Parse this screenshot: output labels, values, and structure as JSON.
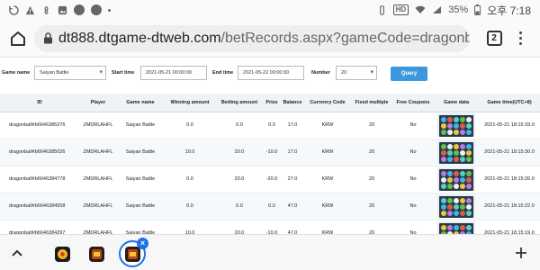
{
  "status_bar": {
    "battery": "35%",
    "time": "오후 7:18",
    "network_badge": "HD"
  },
  "browser": {
    "url_host": "dt888.dtgame-dtweb.com",
    "url_path": "/betRecords.aspx?gameCode=dragonball",
    "tab_count": "2"
  },
  "filters": {
    "game_name_label": "Game name",
    "game_name_value": "Saiyan Battle",
    "start_time_label": "Start time",
    "start_time_value": "2021-05-21 00:00:00",
    "end_time_label": "End time",
    "end_time_value": "2021-05-22 00:00:00",
    "number_label": "Number",
    "number_value": "20",
    "query_label": "Query"
  },
  "table": {
    "columns": [
      "ID",
      "Player",
      "Game name",
      "Winning amount",
      "Betting amount",
      "Prize",
      "Balance",
      "Currency Code",
      "Fixed multiple",
      "Free Coupons",
      "Game data",
      "Game time(UTC+8)"
    ],
    "rows": [
      {
        "id": "dragonball#b6646385276",
        "player": "ZMDRLAHFL",
        "game": "Saiyan Battle",
        "win": "0.0",
        "bet": "0.0",
        "prize": "0.0",
        "balance": "17.0",
        "currency": "KRW",
        "multiple": "20",
        "coupons": "No",
        "time": "2021-05-21 18:15:33.0"
      },
      {
        "id": "dragonball#b6646385026",
        "player": "ZMDRLAHFL",
        "game": "Saiyan Battle",
        "win": "10.0",
        "bet": "20.0",
        "prize": "-10.0",
        "balance": "17.0",
        "currency": "KRW",
        "multiple": "20",
        "coupons": "No",
        "time": "2021-05-21 18:15:30.0"
      },
      {
        "id": "dragonball#b6646384778",
        "player": "ZMDRLAHFL",
        "game": "Saiyan Battle",
        "win": "0.0",
        "bet": "20.0",
        "prize": "-20.0",
        "balance": "27.0",
        "currency": "KRW",
        "multiple": "20",
        "coupons": "No",
        "time": "2021-05-21 18:15:26.0"
      },
      {
        "id": "dragonball#b6646384558",
        "player": "ZMDRLAHFL",
        "game": "Saiyan Battle",
        "win": "0.0",
        "bet": "0.0",
        "prize": "0.0",
        "balance": "47.0",
        "currency": "KRW",
        "multiple": "20",
        "coupons": "No",
        "time": "2021-05-21 18:15:22.0"
      },
      {
        "id": "dragonball#b6646384297",
        "player": "ZMDRLAHFL",
        "game": "Saiyan Battle",
        "win": "10.0",
        "bet": "20.0",
        "prize": "-10.0",
        "balance": "47.0",
        "currency": "KRW",
        "multiple": "20",
        "coupons": "No",
        "time": "2021-05-21 18:15:19.0"
      }
    ]
  },
  "colors": {
    "accent": "#1a73e8",
    "query_button": "#3c97dd",
    "header_bg": "#eef3f7"
  },
  "bottom_tabs": {
    "icons": [
      "collapse-up-icon",
      "game-app-icon",
      "game-app-icon",
      "game-app-icon",
      "plus-icon"
    ]
  }
}
